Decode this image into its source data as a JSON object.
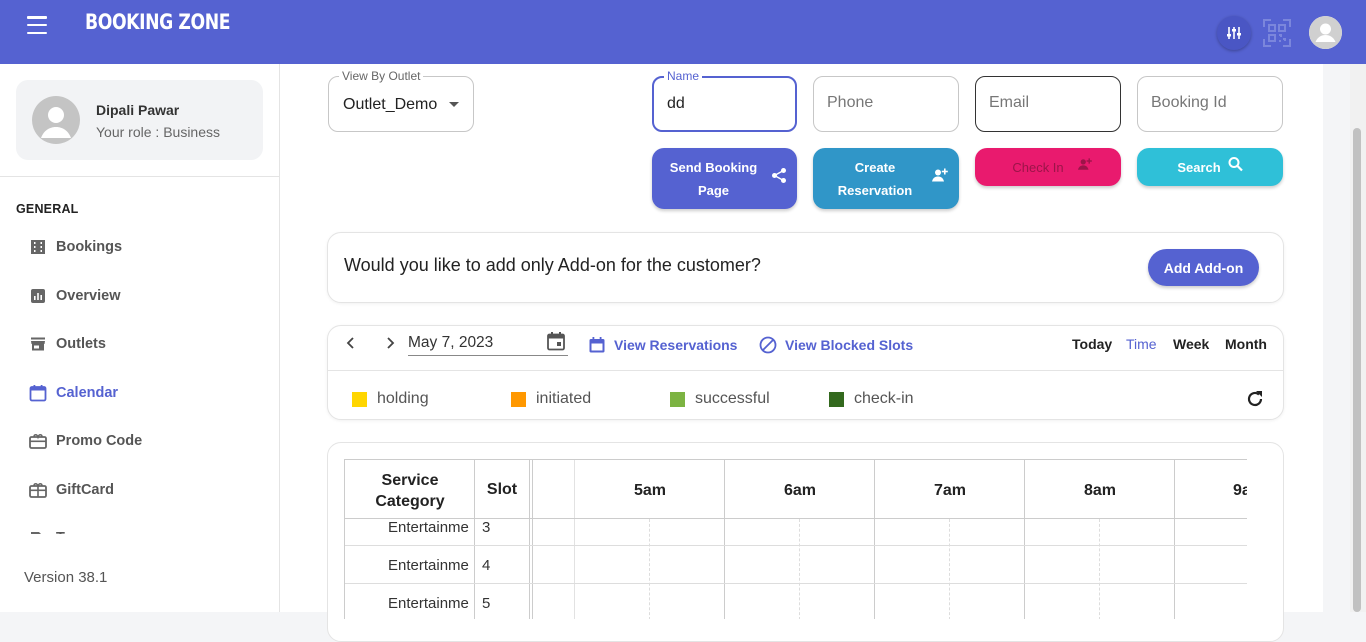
{
  "header": {
    "logo_text": "BOOKING ZONE",
    "brand_color": "#5562d1"
  },
  "sidebar": {
    "user_name": "Dipali Pawar",
    "user_role": "Your role : Business",
    "section_title": "GENERAL",
    "items": [
      {
        "label": "Bookings",
        "icon": "bookings-icon"
      },
      {
        "label": "Overview",
        "icon": "chart-icon"
      },
      {
        "label": "Outlets",
        "icon": "store-icon"
      },
      {
        "label": "Calendar",
        "icon": "calendar-icon",
        "active": true
      },
      {
        "label": "Promo Code",
        "icon": "promo-icon"
      },
      {
        "label": "GiftCard",
        "icon": "gift-icon"
      },
      {
        "label": "Tags",
        "icon": "tag-icon"
      }
    ],
    "version": "Version 38.1"
  },
  "filters": {
    "outlet_label": "View By Outlet",
    "outlet_value": "Outlet_Demo",
    "name_label": "Name",
    "name_value": "dd",
    "phone_placeholder": "Phone",
    "email_placeholder": "Email",
    "booking_id_placeholder": "Booking Id"
  },
  "actions": {
    "send_booking_page": "Send Booking Page",
    "create_reservation": "Create Reservation",
    "check_in": "Check In",
    "search": "Search"
  },
  "addon": {
    "question": "Would you like to add only Add-on for the customer?",
    "button": "Add Add-on"
  },
  "calendar": {
    "date": "May 7, 2023",
    "view_reservations": "View Reservations",
    "view_blocked_slots": "View Blocked Slots",
    "views": [
      "Today",
      "Time",
      "Week",
      "Month"
    ],
    "active_view": "Time",
    "legend": [
      {
        "label": "holding",
        "color": "#ffd600"
      },
      {
        "label": "initiated",
        "color": "#ff9800"
      },
      {
        "label": "successful",
        "color": "#7cb342"
      },
      {
        "label": "check-in",
        "color": "#33691e"
      }
    ]
  },
  "schedule": {
    "col_service": "Service Category",
    "col_slot": "Slot",
    "hours": [
      "5am",
      "6am",
      "7am",
      "8am",
      "9a"
    ],
    "rows": [
      {
        "service": "Entertainme",
        "slot": "3"
      },
      {
        "service": "Entertainme",
        "slot": "4"
      },
      {
        "service": "Entertainme",
        "slot": "5"
      }
    ]
  }
}
